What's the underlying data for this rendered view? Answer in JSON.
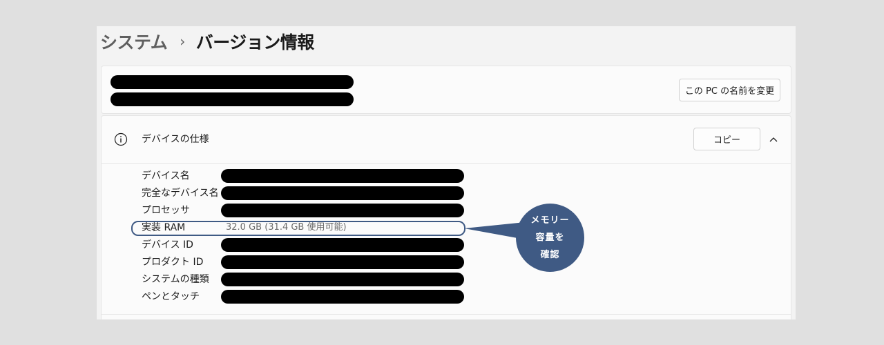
{
  "breadcrumb": {
    "parent": "システム",
    "separator": "›",
    "current": "バージョン情報"
  },
  "device_card": {
    "rename_button": "この PC の名前を変更"
  },
  "specs": {
    "title": "デバイスの仕様",
    "copy_button": "コピー",
    "rows": [
      {
        "label": "デバイス名",
        "value": null,
        "redacted": true
      },
      {
        "label": "完全なデバイス名",
        "value": null,
        "redacted": true
      },
      {
        "label": "プロセッサ",
        "value": null,
        "redacted": true
      },
      {
        "label": "実装 RAM",
        "value": "32.0 GB (31.4 GB 使用可能)",
        "redacted": false
      },
      {
        "label": "デバイス ID",
        "value": null,
        "redacted": true
      },
      {
        "label": "プロダクト ID",
        "value": null,
        "redacted": true
      },
      {
        "label": "システムの種類",
        "value": null,
        "redacted": true
      },
      {
        "label": "ペンとタッチ",
        "value": null,
        "redacted": true
      }
    ]
  },
  "callout": {
    "lines": [
      "メモリー",
      "容量を",
      "確認"
    ],
    "color": "#3f5a84"
  },
  "icons": {
    "info": "info-icon",
    "expand": "chevron-up-icon"
  }
}
